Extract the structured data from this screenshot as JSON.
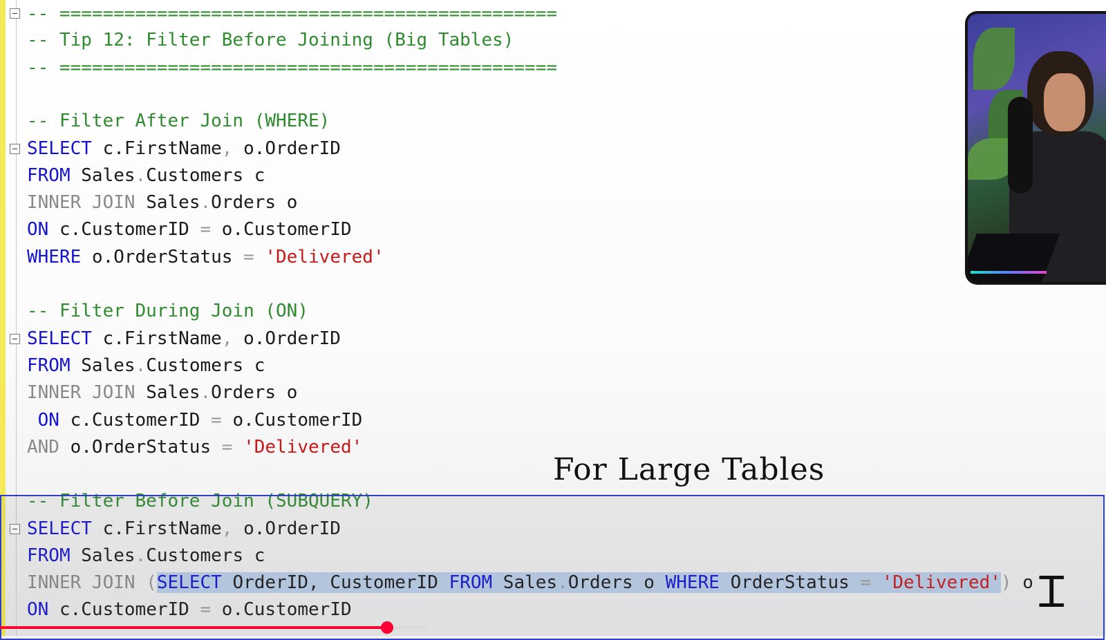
{
  "lines": [
    "-- ==============================================",
    "-- Tip 12: Filter Before Joining (Big Tables)",
    "-- ==============================================",
    "-- Filter After Join (WHERE)",
    "SELECT",
    "c.FirstName",
    "o.OrderID",
    "FROM",
    "Sales",
    "Customers c",
    "INNER JOIN",
    "Orders o",
    "ON",
    "c.CustomerID",
    "o.CustomerID",
    "WHERE",
    "o.OrderStatus",
    "'Delivered'",
    "-- Filter During Join (ON)",
    "AND",
    "-- Filter Before Join (SUBQUERY)",
    "OrderID, CustomerID",
    "OrderStatus",
    "o"
  ],
  "caption": "For Large Tables",
  "video": {
    "progress_fraction": 0.35
  }
}
